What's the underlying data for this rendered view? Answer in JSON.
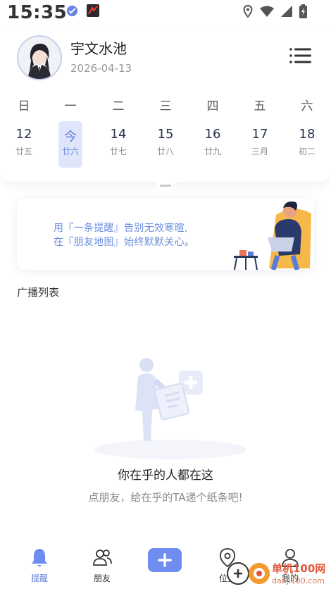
{
  "status_bar": {
    "time": "15:35",
    "icons": [
      "app-notification-icon",
      "app-notification-icon-2",
      "location-icon",
      "wifi-icon",
      "signal-icon",
      "battery-icon"
    ]
  },
  "profile": {
    "name": "宇文水池",
    "date": "2026-04-13"
  },
  "calendar": {
    "weekdays": [
      "日",
      "一",
      "二",
      "三",
      "四",
      "五",
      "六"
    ],
    "days": [
      {
        "num": "12",
        "lunar": "廿五",
        "today": false
      },
      {
        "num": "今",
        "lunar": "廿六",
        "today": true
      },
      {
        "num": "14",
        "lunar": "廿七",
        "today": false
      },
      {
        "num": "15",
        "lunar": "廿八",
        "today": false
      },
      {
        "num": "16",
        "lunar": "廿九",
        "today": false
      },
      {
        "num": "17",
        "lunar": "三月",
        "today": false
      },
      {
        "num": "18",
        "lunar": "初二",
        "today": false
      }
    ]
  },
  "banner": {
    "line1": "用『一条提醒』告别无效寒暄,",
    "line2": "在『朋友地图』始终默默关心。"
  },
  "section_title": "广播列表",
  "empty_state": {
    "title": "你在乎的人都在这",
    "subtitle": "点朋友，给在乎的TA递个纸条吧!"
  },
  "tabs": [
    {
      "label": "提醒",
      "icon": "bell-icon",
      "active": true
    },
    {
      "label": "朋友",
      "icon": "friends-icon",
      "active": false
    },
    {
      "label": "位置",
      "icon": "location-pin-icon",
      "active": false
    },
    {
      "label": "我的",
      "icon": "person-icon",
      "active": false
    }
  ],
  "watermark": {
    "title": "单机100网",
    "url": "danji100.com"
  },
  "colors": {
    "accent": "#6f8df0",
    "today_bg": "#dfe5fb",
    "banner_text": "#6b8ee0"
  }
}
